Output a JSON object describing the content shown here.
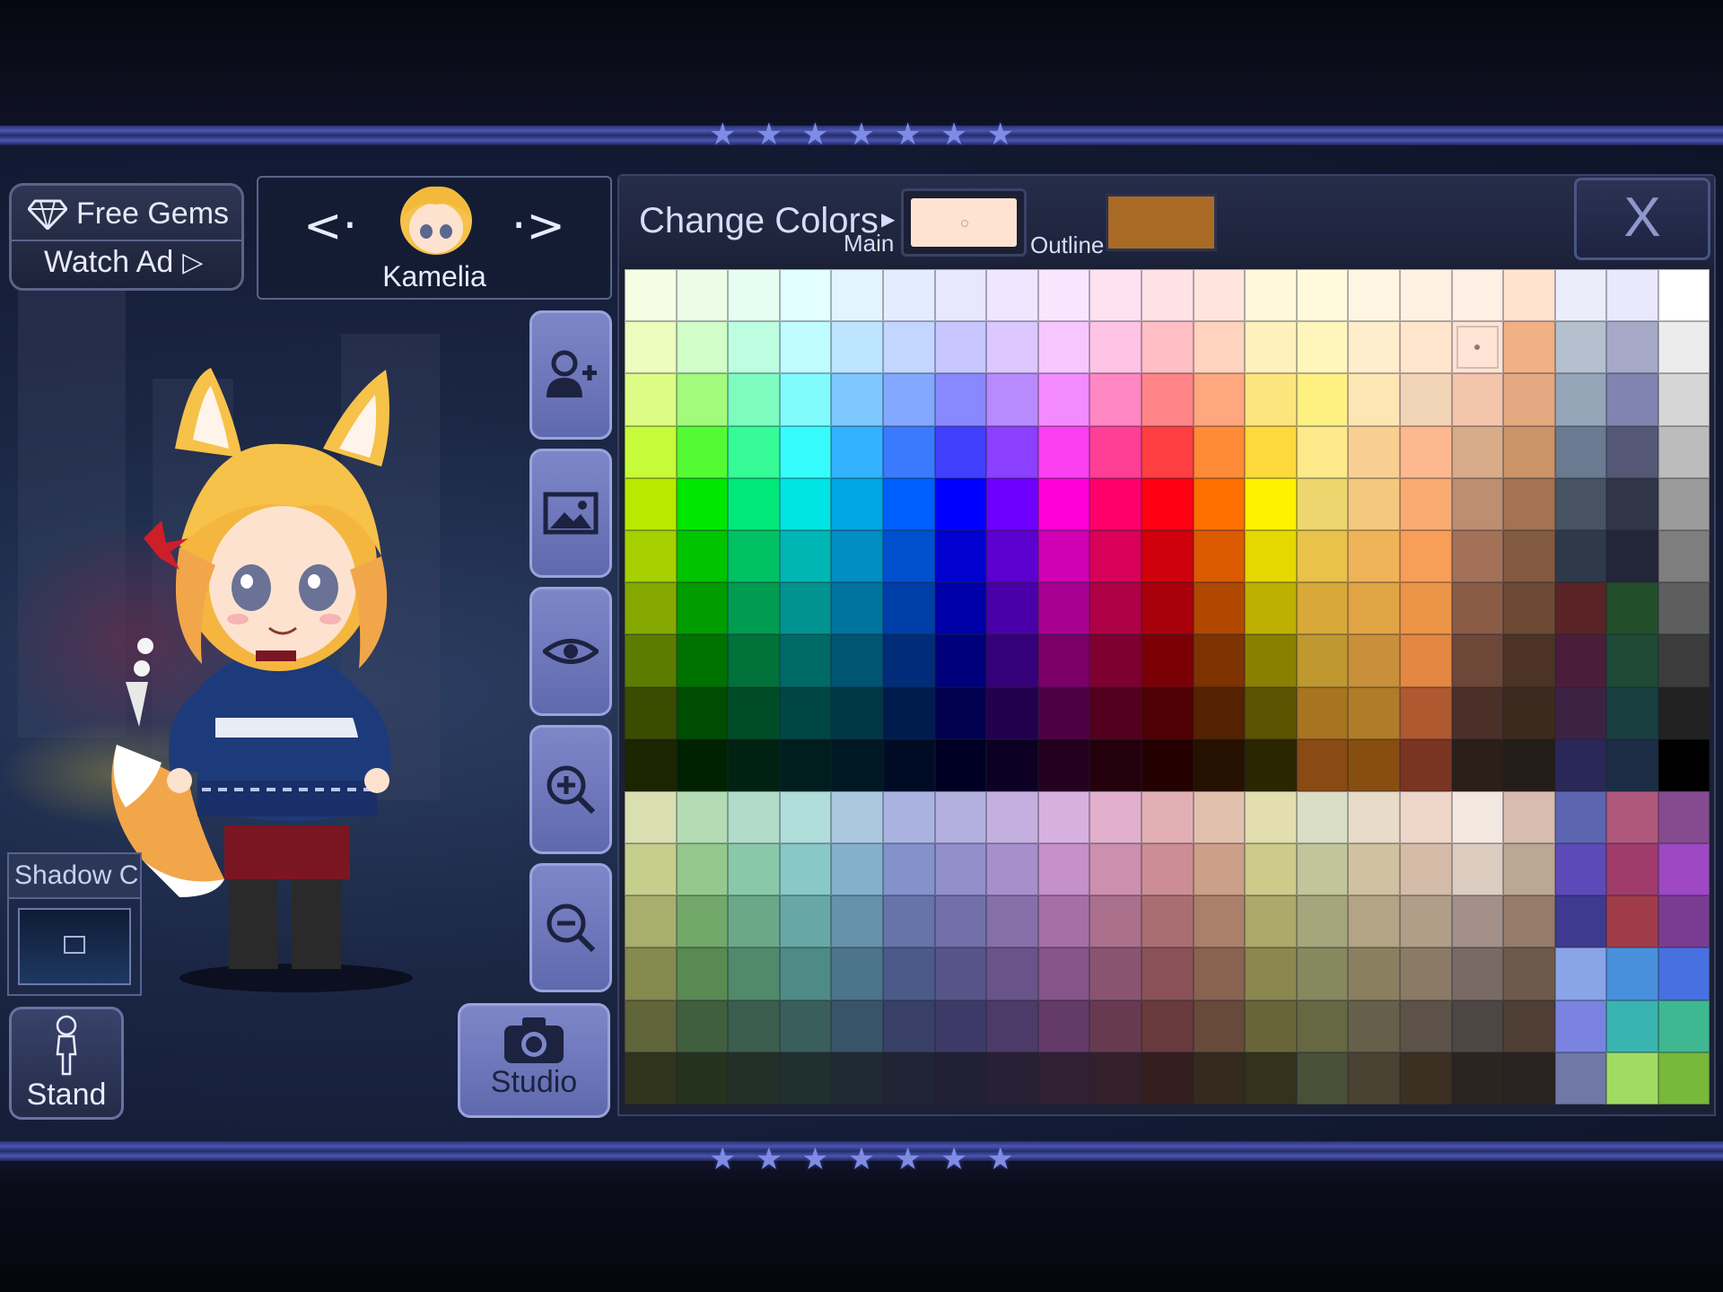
{
  "free_gems": {
    "label": "Free Gems",
    "watch_ad": "Watch Ad"
  },
  "character": {
    "name": "Kamelia"
  },
  "shadow": {
    "label": "Shadow C."
  },
  "buttons": {
    "stand": "Stand",
    "studio": "Studio"
  },
  "panel": {
    "title": "Change Colors",
    "main_label": "Main",
    "outline_label": "Outline",
    "close_label": "X",
    "main_color": "#ffe3d2",
    "outline_color": "#a86a24",
    "selected_cell": [
      1,
      16
    ]
  },
  "palette": [
    [
      "#f5fde3",
      "#ebfde7",
      "#e6fdf1",
      "#e2feff",
      "#e4f4ff",
      "#e4ecff",
      "#e8e7ff",
      "#f0e6ff",
      "#fae5ff",
      "#ffe2f2",
      "#ffe2e6",
      "#ffe5dd",
      "#fff8db",
      "#fffadc",
      "#fff6e2",
      "#fff1e2",
      "#ffefe4",
      "#ffe3cf",
      "#ecedfb",
      "#eae8fb",
      "#ffffff"
    ],
    [
      "#ecfdbd",
      "#d1fdc8",
      "#bdfde0",
      "#bffcff",
      "#bde5ff",
      "#c2d6ff",
      "#c7c6ff",
      "#dcc7ff",
      "#f6c6ff",
      "#ffc3e5",
      "#ffbfc4",
      "#ffd3bd",
      "#fff1bb",
      "#fff6bc",
      "#ffeecc",
      "#ffe5cc",
      "#ffe4d5",
      "#f0b184",
      "#b5c0cf",
      "#a6a8c8",
      "#ececec"
    ],
    [
      "#dcfc85",
      "#a2fb7c",
      "#7efcc0",
      "#82fbfd",
      "#7ec8ff",
      "#83a8ff",
      "#8888ff",
      "#b88aff",
      "#f38afd",
      "#ff87c4",
      "#ff8588",
      "#ffa77e",
      "#fde57d",
      "#fff082",
      "#fde6b4",
      "#f2d4b7",
      "#f3c6ab",
      "#e4a981",
      "#97a5b8",
      "#8183b0",
      "#d6d6d6"
    ],
    [
      "#c5fb38",
      "#54fb34",
      "#36fb96",
      "#37fcfd",
      "#33b2ff",
      "#3b7afe",
      "#4040fe",
      "#8a40fe",
      "#fb40f2",
      "#ff3e96",
      "#ff3e42",
      "#ff8b38",
      "#fdd93c",
      "#fde98a",
      "#f8cf90",
      "#fdb890",
      "#d8ac88",
      "#cb9468",
      "#6a7a90",
      "#545876",
      "#bcbcbc"
    ],
    [
      "#bae900",
      "#00e800",
      "#00e878",
      "#00e4e4",
      "#00a6e4",
      "#0060ff",
      "#0000ff",
      "#6e00ff",
      "#ff00d8",
      "#ff006a",
      "#ff0012",
      "#ff7000",
      "#fff200",
      "#eed66e",
      "#f4c87e",
      "#f9ab70",
      "#bd8e71",
      "#a47352",
      "#475360",
      "#303548",
      "#9b9b9b"
    ],
    [
      "#a6d000",
      "#00c400",
      "#00c264",
      "#00b6b4",
      "#008ec4",
      "#0050d0",
      "#0000d0",
      "#5c00d0",
      "#d000b4",
      "#d80058",
      "#d0000c",
      "#dc5a00",
      "#e4d800",
      "#e8c24a",
      "#f0b458",
      "#f89e58",
      "#a37158",
      "#825a40",
      "#2e3a4a",
      "#232638",
      "#7e7e7e"
    ],
    [
      "#84a800",
      "#009c00",
      "#009c50",
      "#009390",
      "#00749e",
      "#003ea8",
      "#0000a8",
      "#4a00a8",
      "#a80090",
      "#ae0044",
      "#a8000a",
      "#b04800",
      "#bdb000",
      "#d8a838",
      "#e0a444",
      "#ec9448",
      "#8a5c46",
      "#6d4a34",
      "#5a2426",
      "#234e2a",
      "#5e5e5e"
    ],
    [
      "#5c7c00",
      "#007200",
      "#00723a",
      "#006a68",
      "#005474",
      "#002c7a",
      "#00007a",
      "#36007a",
      "#7a0068",
      "#7e0030",
      "#7a0006",
      "#7e3300",
      "#8a8000",
      "#c09830",
      "#c8903a",
      "#e48740",
      "#6d4738",
      "#4d3324",
      "#4a1e3a",
      "#1e4a36",
      "#3c3c3c"
    ],
    [
      "#3a4c00",
      "#004c00",
      "#004c26",
      "#004646",
      "#003848",
      "#001c4e",
      "#00004e",
      "#22004e",
      "#4e0044",
      "#52001e",
      "#4e0002",
      "#542200",
      "#5c5400",
      "#a87420",
      "#b07c28",
      "#b05830",
      "#4a3028",
      "#3c2a1e",
      "#3e2244",
      "#183e40",
      "#222222"
    ],
    [
      "#1c2400",
      "#002200",
      "#002212",
      "#001e1e",
      "#001822",
      "#000c24",
      "#000024",
      "#0e0024",
      "#24001e",
      "#24000c",
      "#240000",
      "#261000",
      "#2a2600",
      "#8a4a14",
      "#884e10",
      "#7a3422",
      "#2c1e18",
      "#241c16",
      "#2a2858",
      "#1c2c44",
      "#000000"
    ],
    [
      "#dadfb2",
      "#b3dcb5",
      "#b2dcca",
      "#b0dcda",
      "#aac9e0",
      "#aab3e0",
      "#b3b0e0",
      "#c4b0e0",
      "#d8b0df",
      "#e2b0cc",
      "#e2b0b4",
      "#e2c0ae",
      "#e2deae",
      "#dadec4",
      "#e8dcc8",
      "#eed6c8",
      "#f2e8e0",
      "#d8bcb0",
      "#5d64b0",
      "#b0587c",
      "#864a90"
    ],
    [
      "#c6ce8c",
      "#94c88c",
      "#8ac8aa",
      "#88c8c6",
      "#84b0cc",
      "#8492cc",
      "#9290cc",
      "#a690cc",
      "#c690c8",
      "#cc90ae",
      "#cc8e94",
      "#cca088",
      "#cccb8a",
      "#c2c49a",
      "#d0c2a0",
      "#d4bca8",
      "#dcccc0",
      "#bca694",
      "#5c4ab8",
      "#a03c6c",
      "#9e48c4"
    ],
    [
      "#a8ae6c",
      "#72a86a",
      "#6aa888",
      "#68a8a4",
      "#6692aa",
      "#6674aa",
      "#7270aa",
      "#8670aa",
      "#a670a6",
      "#aa708c",
      "#aa6e72",
      "#aa806a",
      "#aca96a",
      "#a6a67c",
      "#b2a484",
      "#b09e88",
      "#a49088",
      "#967a6a",
      "#3e3a90",
      "#a03c4a",
      "#7a3c92"
    ],
    [
      "#858a4e",
      "#588a52",
      "#508a6a",
      "#4e8a86",
      "#4c748a",
      "#4c5a8a",
      "#565488",
      "#685488",
      "#865488",
      "#8a5470",
      "#8a5256",
      "#8a6250",
      "#8a884e",
      "#86885e",
      "#8a8060",
      "#8a7a66",
      "#7a6a66",
      "#6e5a4c",
      "#8aa4e8",
      "#4890dc",
      "#4870e0"
    ],
    [
      "#60653a",
      "#405f3c",
      "#3c5e4e",
      "#3a5e5c",
      "#385468",
      "#384068",
      "#3e3a68",
      "#4c3a68",
      "#643a68",
      "#683a52",
      "#683a3c",
      "#684a3a",
      "#686638",
      "#666844",
      "#66604a",
      "#5c5248",
      "#4e4642",
      "#4e3e34",
      "#7a84e0",
      "#3ab4b0",
      "#3eb890"
    ],
    [
      "#30341c",
      "#24321e",
      "#223028",
      "#20302e",
      "#202a32",
      "#202434",
      "#222034",
      "#282034",
      "#322034",
      "#34202a",
      "#341e1e",
      "#342a1e",
      "#34321c",
      "#485038",
      "#4a4232",
      "#3c3022",
      "#2c2420",
      "#2a2220",
      "#7078a8",
      "#a0dc64",
      "#78b83a"
    ]
  ]
}
